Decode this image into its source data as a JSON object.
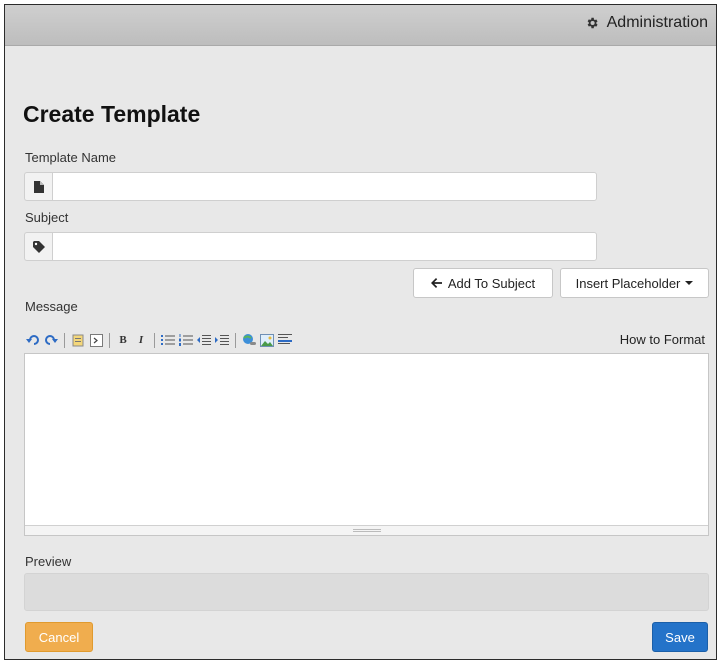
{
  "header": {
    "admin_label": "Administration",
    "admin_icon": "gear-icon"
  },
  "page": {
    "title": "Create Template"
  },
  "form": {
    "template_name": {
      "label": "Template Name",
      "value": "",
      "placeholder": "",
      "icon": "file-icon"
    },
    "subject": {
      "label": "Subject",
      "value": "",
      "placeholder": "",
      "icon": "tag-icon"
    },
    "add_to_subject_label": "Add To Subject",
    "insert_placeholder_label": "Insert Placeholder",
    "message_label": "Message",
    "how_to_format": "How to Format",
    "preview_label": "Preview"
  },
  "toolbar": {
    "bold": "B",
    "italic": "I",
    "icons": [
      "undo-icon",
      "redo-icon",
      "paste-icon",
      "source-icon",
      "bold-icon",
      "italic-icon",
      "bulleted-list-icon",
      "numbered-list-icon",
      "outdent-icon",
      "indent-icon",
      "link-icon",
      "image-icon",
      "horizontal-rule-icon"
    ]
  },
  "footer": {
    "cancel_label": "Cancel",
    "save_label": "Save"
  },
  "colors": {
    "cancel": "#f0ad4e",
    "save": "#2473c9",
    "toolbar_icon": "#2d6bc4"
  }
}
